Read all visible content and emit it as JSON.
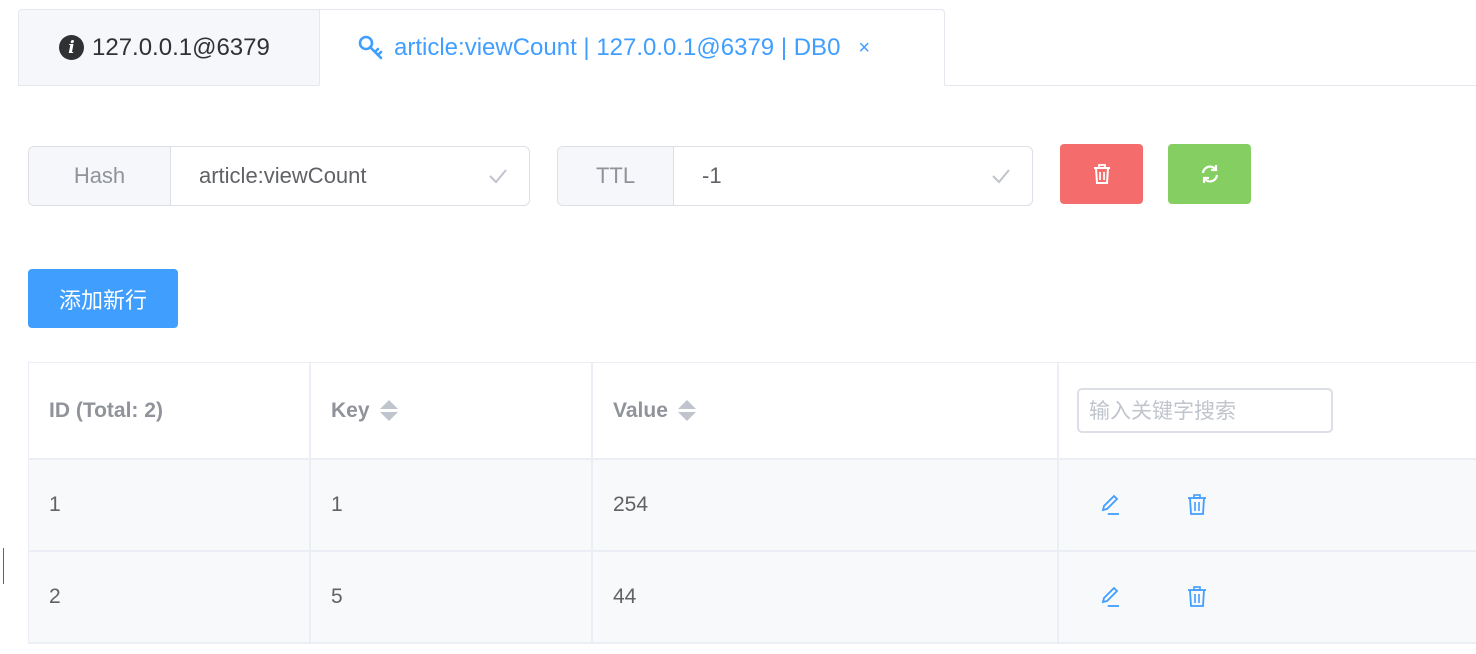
{
  "tabs": {
    "info_label": "127.0.0.1@6379",
    "active_label": "article:viewCount | 127.0.0.1@6379 | DB0",
    "close_glyph": "×"
  },
  "key_form": {
    "type_label": "Hash",
    "key_name": "article:viewCount",
    "ttl_label": "TTL",
    "ttl_value": "-1"
  },
  "toolbar": {
    "add_row_label": "添加新行"
  },
  "table": {
    "columns": {
      "id": "ID (Total: 2)",
      "key": "Key",
      "value": "Value"
    },
    "search_placeholder": "输入关键字搜索",
    "rows": [
      {
        "id": "1",
        "key": "1",
        "value": "254"
      },
      {
        "id": "2",
        "key": "5",
        "value": "44"
      }
    ]
  },
  "colors": {
    "primary": "#409eff",
    "danger": "#f56c6c",
    "success": "#85ce61"
  }
}
